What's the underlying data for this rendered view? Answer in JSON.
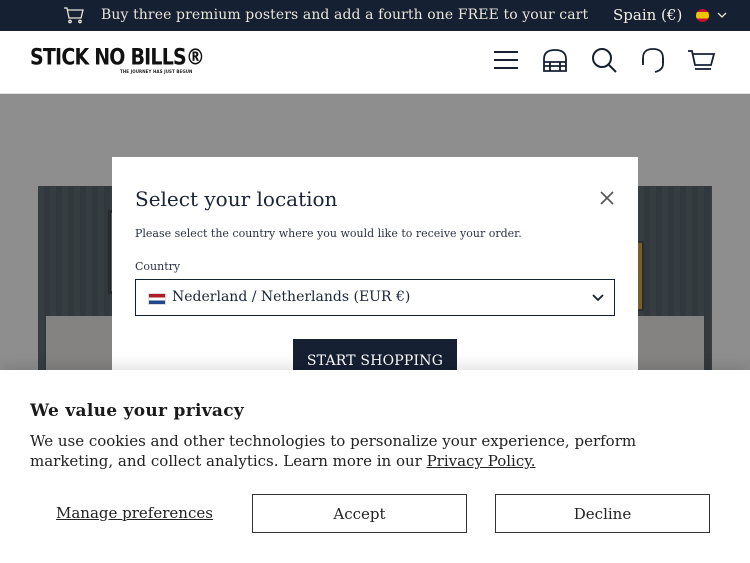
{
  "announcement": {
    "promo_text": "Buy three premium posters and add a fourth one FREE to your cart",
    "locale_label": "Spain (€)"
  },
  "header": {
    "logo_text": "STICK NO BILLS®",
    "logo_tagline": "THE JOURNEY HAS JUST BEGUN"
  },
  "location_modal": {
    "title": "Select your location",
    "description": "Please select the country where you would like to receive your order.",
    "country_label": "Country",
    "selected_country": "Nederland / Netherlands (EUR €)",
    "start_button": "START SHOPPING"
  },
  "privacy": {
    "title": "We value your privacy",
    "text": "We use cookies and other technologies to personalize your experience, perform marketing, and collect analytics. Learn more in our ",
    "policy_link": "Privacy Policy.",
    "manage_label": "Manage preferences",
    "accept_label": "Accept",
    "decline_label": "Decline"
  },
  "colors": {
    "navy": "#152033",
    "overlay": "rgba(50,50,50,0.55)"
  },
  "icons": [
    "cart-mini-icon",
    "chevron-down-icon",
    "menu-icon",
    "store-icon",
    "search-icon",
    "support-icon",
    "cart-icon",
    "close-icon"
  ]
}
